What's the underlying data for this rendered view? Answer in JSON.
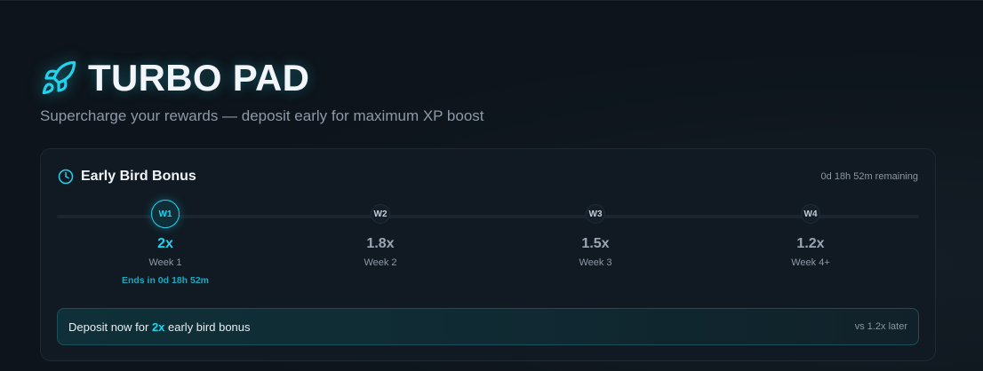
{
  "header": {
    "title": "TURBO PAD",
    "subtitle": "Supercharge your rewards — deposit early for maximum XP boost",
    "icon": "rocket-icon"
  },
  "card": {
    "title": "Early Bird Bonus",
    "icon": "clock-icon",
    "remaining": "0d 18h 52m remaining",
    "steps": [
      {
        "badge": "W1",
        "multiplier": "2x",
        "label": "Week 1",
        "ends": "Ends in 0d 18h 52m",
        "active": true
      },
      {
        "badge": "W2",
        "multiplier": "1.8x",
        "label": "Week 2",
        "active": false
      },
      {
        "badge": "W3",
        "multiplier": "1.5x",
        "label": "Week 3",
        "active": false
      },
      {
        "badge": "W4",
        "multiplier": "1.2x",
        "label": "Week 4+",
        "active": false
      }
    ],
    "banner": {
      "prefix": "Deposit now for ",
      "highlight": "2x",
      "suffix": " early bird bonus",
      "right": "vs 1.2x later"
    }
  },
  "colors": {
    "accent": "#22d3ee",
    "background": "#0d141b",
    "card": "#111a23"
  }
}
